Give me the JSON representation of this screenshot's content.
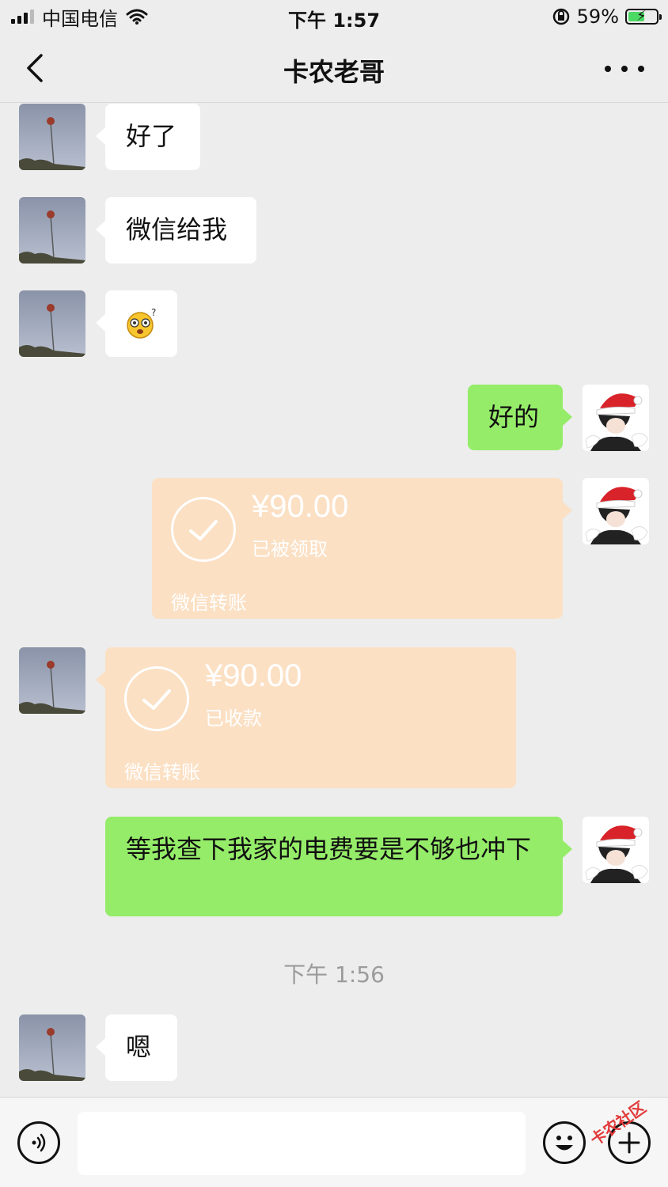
{
  "status_bar": {
    "carrier": "中国电信",
    "time": "下午 1:57",
    "battery": "59%",
    "battery_level": 0.59
  },
  "nav": {
    "title": "卡农老哥"
  },
  "messages": {
    "m1": {
      "text": "好了"
    },
    "m2": {
      "text": "微信给我"
    },
    "m3": {
      "emoji": "dizzy-confused-emoji"
    },
    "m4": {
      "text": "好的"
    },
    "t1": {
      "amount": "¥90.00",
      "status": "已被领取",
      "label": "微信转账"
    },
    "t2": {
      "amount": "¥90.00",
      "status": "已收款",
      "label": "微信转账"
    },
    "m5": {
      "text": "等我查下我家的电费要是不够也冲下"
    },
    "m6": {
      "text": "嗯"
    }
  },
  "timestamp": "下午 1:56",
  "watermark": "卡农社区",
  "colors": {
    "background": "#ededed",
    "green_bubble": "#95ec69",
    "transfer_bubble": "#fbe0c4"
  }
}
